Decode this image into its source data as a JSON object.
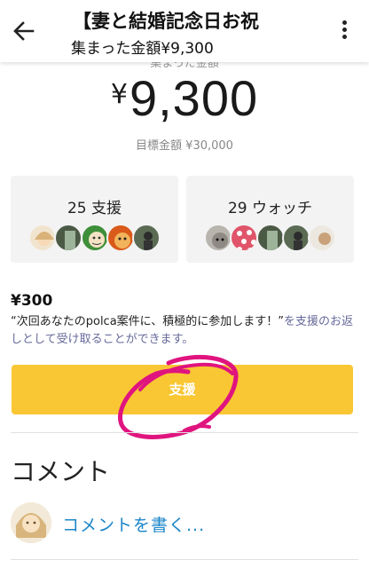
{
  "header": {
    "title": "【妻と結婚記念日お祝",
    "subtitle": "集まった金額¥9,300",
    "back_icon": "arrow-left-icon",
    "more_icon": "more-vertical-icon"
  },
  "summary": {
    "collected_label": "集まった金額",
    "currency": "¥",
    "amount": "9,300",
    "goal": "目標金額 ¥30,000"
  },
  "stats": {
    "supporters": "25 支援",
    "watchers": "29 ウォッチ"
  },
  "reward": {
    "price": "¥300",
    "quote": "“次回あなたのpolca案件に、積極的に参加します！”",
    "suffix": "を支援のお返しとして受け取ることができます。"
  },
  "support_button": {
    "label": "支援"
  },
  "comments": {
    "heading": "コメント",
    "write_link": "コメントを書く..."
  },
  "colors": {
    "button": "#f9c734",
    "scribble": "#e0147f",
    "link": "#1c86c9",
    "card_bg": "#f3f3f3"
  }
}
